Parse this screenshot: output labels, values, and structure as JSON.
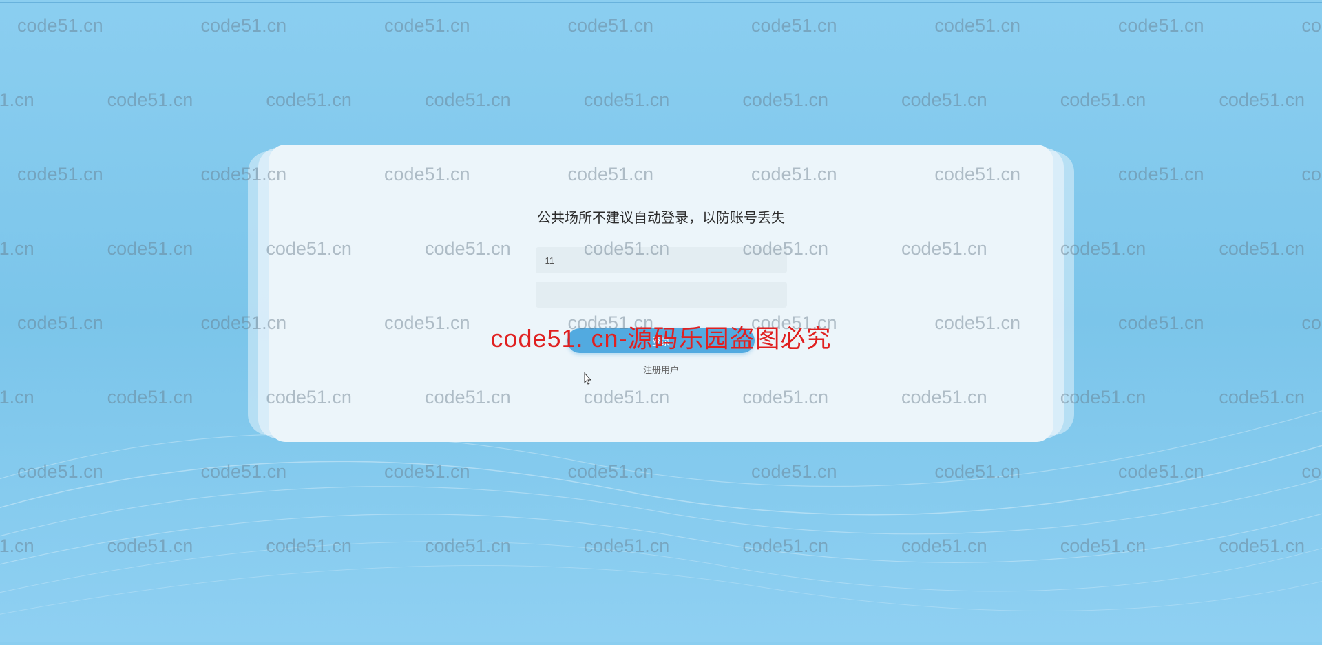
{
  "watermark": {
    "text": "code51.cn"
  },
  "login": {
    "warning": "公共场所不建议自动登录，以防账号丢失",
    "username_value": "11",
    "password_value": "",
    "login_button_label": "登录",
    "register_link_label": "注册用户"
  },
  "overlay": {
    "text": "code51. cn-源码乐园盗图必究"
  }
}
